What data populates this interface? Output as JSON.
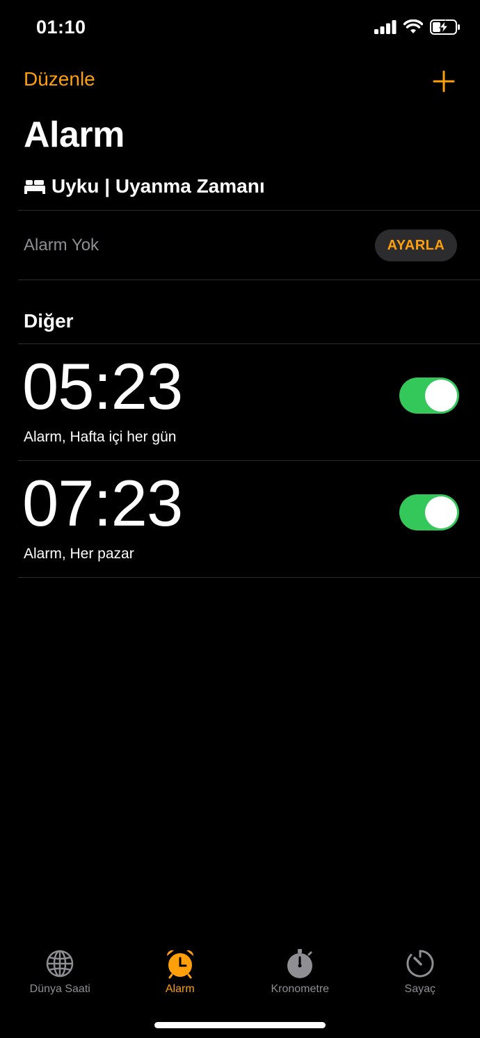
{
  "status_bar": {
    "time": "01:10"
  },
  "nav": {
    "edit_label": "Düzenle",
    "add_icon": "plus-icon"
  },
  "page": {
    "title": "Alarm"
  },
  "sleep_section": {
    "icon": "bed-icon",
    "title": "Uyku | Uyanma Zamanı",
    "status_text": "Alarm Yok",
    "set_button_label": "AYARLA"
  },
  "other_section": {
    "title": "Diğer"
  },
  "alarms": [
    {
      "time": "05:23",
      "label": "Alarm, Hafta içi her gün",
      "enabled": true
    },
    {
      "time": "07:23",
      "label": "Alarm, Her pazar",
      "enabled": true
    }
  ],
  "tabs": [
    {
      "label": "Dünya Saati",
      "icon": "globe-icon",
      "active": false
    },
    {
      "label": "Alarm",
      "icon": "alarm-clock-icon",
      "active": true
    },
    {
      "label": "Kronometre",
      "icon": "stopwatch-icon",
      "active": false
    },
    {
      "label": "Sayaç",
      "icon": "timer-icon",
      "active": false
    }
  ],
  "colors": {
    "accent": "#ff9f0a",
    "toggle_on": "#34c759",
    "background": "#000000",
    "secondary_text": "#8e8e93"
  }
}
